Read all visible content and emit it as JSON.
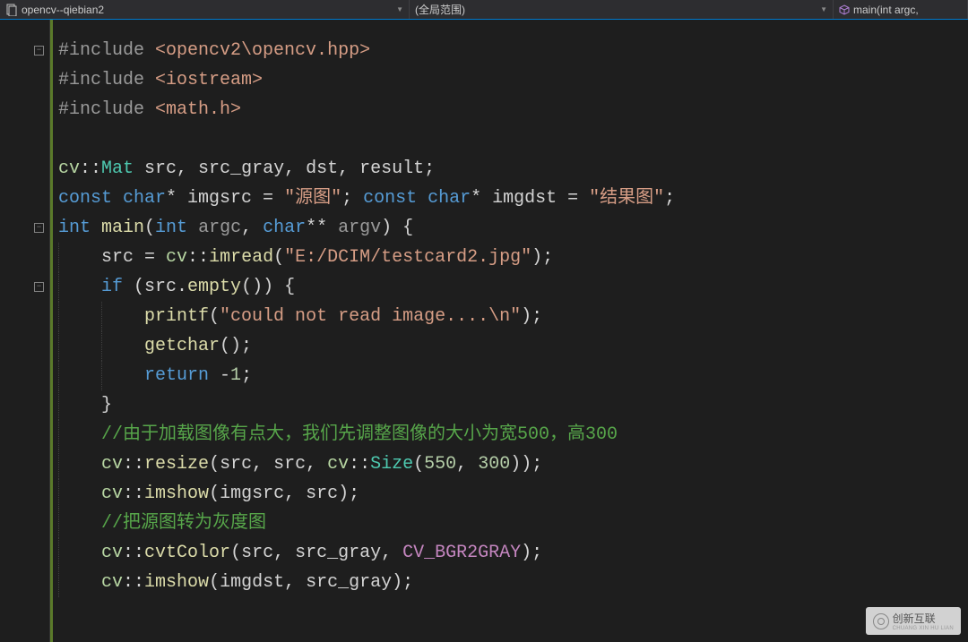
{
  "toolbar": {
    "project": "opencv--qiebian2",
    "scope": "(全局范围)",
    "function": "main(int argc,"
  },
  "code": {
    "l1": {
      "pre": "#include ",
      "inc": "<opencv2\\opencv.hpp>"
    },
    "l2": {
      "pre": "#include ",
      "inc": "<iostream>"
    },
    "l3": {
      "pre": "#include ",
      "inc": "<math.h>"
    },
    "l5a": "cv",
    "l5b": "::",
    "l5c": "Mat",
    "l5d": " src, src_gray, dst, result;",
    "l6a": "const ",
    "l6b": "char",
    "l6c": "* imgsrc = ",
    "l6d": "\"源图\"",
    "l6e": "; ",
    "l6f": "const ",
    "l6g": "char",
    "l6h": "* imgdst = ",
    "l6i": "\"结果图\"",
    "l6j": ";",
    "l7a": "int ",
    "l7b": "main",
    "l7c": "(",
    "l7d": "int",
    "l7e": " ",
    "l7f": "argc",
    "l7g": ", ",
    "l7h": "char",
    "l7i": "** ",
    "l7j": "argv",
    "l7k": ") {",
    "l8a": "    src = ",
    "l8b": "cv",
    "l8c": "::",
    "l8d": "imread",
    "l8e": "(",
    "l8f": "\"E:/DCIM/testcard2.jpg\"",
    "l8g": ");",
    "l9a": "    ",
    "l9b": "if",
    "l9c": " (src.",
    "l9d": "empty",
    "l9e": "()) {",
    "l10a": "        ",
    "l10b": "printf",
    "l10c": "(",
    "l10d": "\"could not read image....\\n\"",
    "l10e": ");",
    "l11a": "        ",
    "l11b": "getchar",
    "l11c": "();",
    "l12a": "        ",
    "l12b": "return",
    "l12c": " -",
    "l12d": "1",
    "l12e": ";",
    "l13a": "    }",
    "l14a": "    ",
    "l14b": "//由于加载图像有点大，我们先调整图像的大小为宽500，高300",
    "l15a": "    ",
    "l15b": "cv",
    "l15c": "::",
    "l15d": "resize",
    "l15e": "(src, src, ",
    "l15f": "cv",
    "l15g": "::",
    "l15h": "Size",
    "l15i": "(",
    "l15j": "550",
    "l15k": ", ",
    "l15l": "300",
    "l15m": "));",
    "l16a": "    ",
    "l16b": "cv",
    "l16c": "::",
    "l16d": "imshow",
    "l16e": "(imgsrc, src);",
    "l17a": "    ",
    "l17b": "//把源图转为灰度图",
    "l18a": "    ",
    "l18b": "cv",
    "l18c": "::",
    "l18d": "cvtColor",
    "l18e": "(src, src_gray, ",
    "l18f": "CV_BGR2GRAY",
    "l18g": ");",
    "l19a": "    ",
    "l19b": "cv",
    "l19c": "::",
    "l19d": "imshow",
    "l19e": "(imgdst, src_gray);"
  },
  "watermark": {
    "brand": "创新互联",
    "sub": "CHUANG XIN HU LIAN"
  }
}
